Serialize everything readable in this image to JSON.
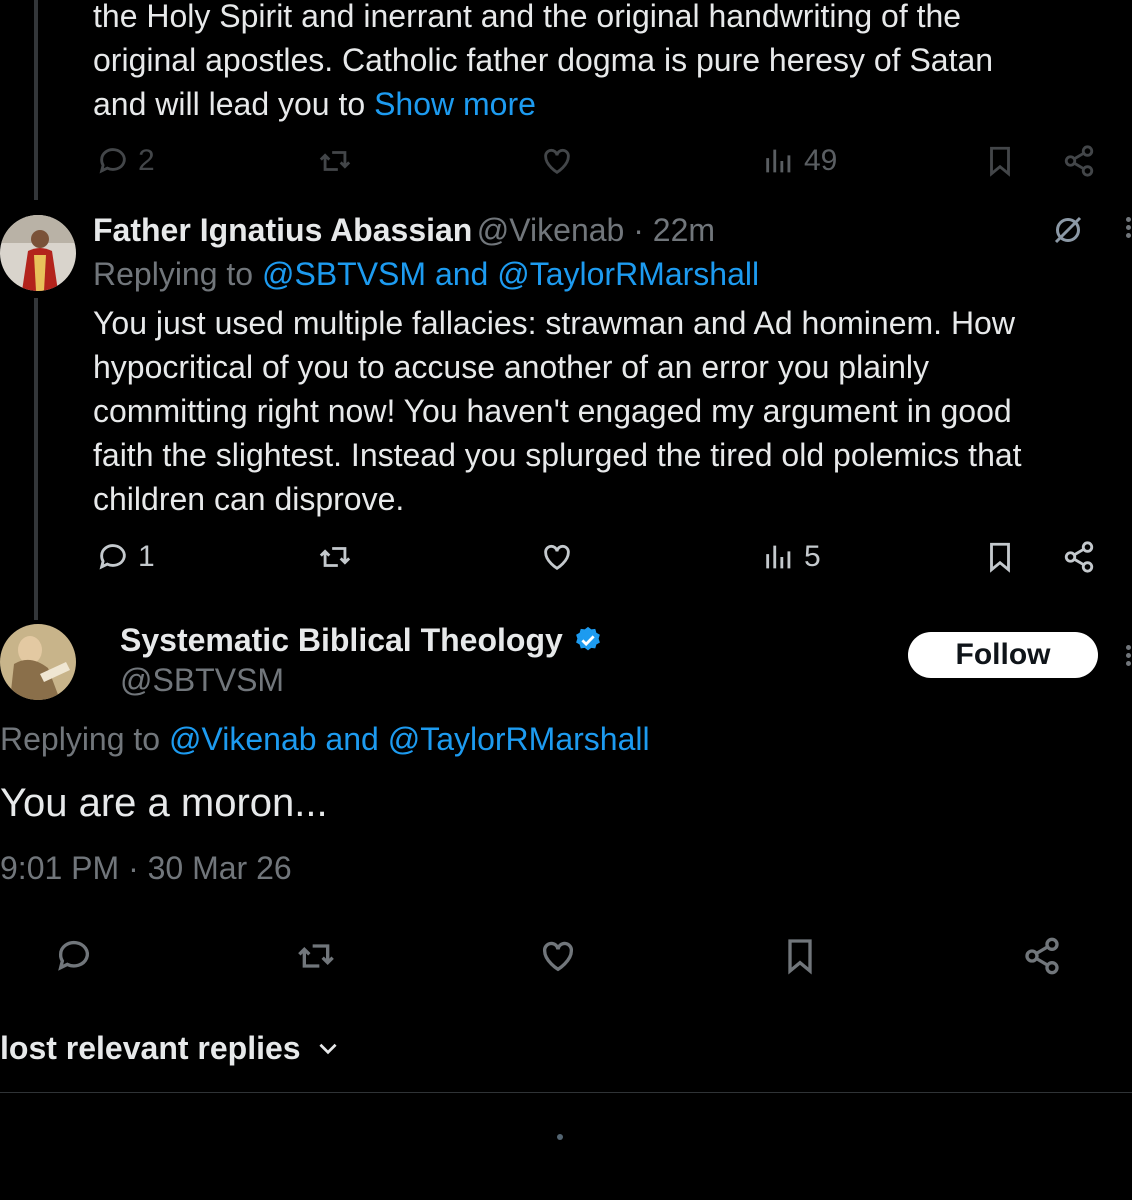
{
  "colors": {
    "background": "#000000",
    "text": "#e7e9ea",
    "muted": "#71767b",
    "link": "#1d9bf0",
    "verified": "#1d9bf0"
  },
  "tweet1": {
    "line1": "the Holy Spirit and inerrant and the original handwriting of the",
    "line2": "original apostles. Catholic father dogma is pure heresy of Satan",
    "line3_prefix": "and will lead you to ",
    "show_more": "Show more",
    "actions": {
      "replies": "2",
      "views": "49"
    }
  },
  "tweet2": {
    "author_name": "Father Ignatius Abassian",
    "handle": "@Vikenab",
    "separator": " · ",
    "time": "22m",
    "replying_to_label": "Replying to ",
    "replying_handle_1": "@SBTVSM",
    "replying_and": " and ",
    "replying_handle_2": "@TaylorRMarshall",
    "text_lines": [
      "You just used multiple fallacies: strawman and Ad hominem. How",
      "hypocritical of you to accuse another of an error you plainly",
      "committing right now! You haven't engaged my argument in good",
      "faith the slightest. Instead you splurged the tired old polemics that",
      "children can disprove."
    ],
    "actions": {
      "replies": "1",
      "views": "5"
    }
  },
  "main_tweet": {
    "author_name": "Systematic Biblical Theology",
    "handle": "@SBTVSM",
    "follow_label": "Follow",
    "replying_to_label": "Replying to ",
    "replying_handle_1": "@Vikenab",
    "replying_and": " and ",
    "replying_handle_2": "@TaylorRMarshall",
    "text": "You are a moron...",
    "timestamp": "9:01 PM · 30 Mar 26"
  },
  "replies_sort": {
    "label": "lost relevant replies"
  },
  "icons": [
    "reply-icon",
    "retweet-icon",
    "like-icon",
    "views-icon",
    "bookmark-icon",
    "share-icon",
    "grok-icon",
    "more-icon",
    "verified-badge-icon",
    "chevron-down-icon"
  ]
}
